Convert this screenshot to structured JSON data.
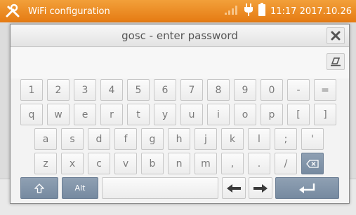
{
  "statusbar": {
    "title": "WiFi configuration",
    "time": "11:17 2017.10.26",
    "icons": [
      "tools-icon",
      "signal-icon",
      "plug-icon",
      "battery-icon"
    ]
  },
  "dialog": {
    "title": "gosc - enter password",
    "password_value": "",
    "close_icon": "close-icon",
    "clear_icon": "eraser-icon"
  },
  "keyboard": {
    "row1": [
      "1",
      "2",
      "3",
      "4",
      "5",
      "6",
      "7",
      "8",
      "9",
      "0",
      "-",
      "="
    ],
    "row2": [
      "q",
      "w",
      "e",
      "r",
      "t",
      "y",
      "u",
      "i",
      "o",
      "p",
      "[",
      "]"
    ],
    "row3": [
      "a",
      "s",
      "d",
      "f",
      "g",
      "h",
      "j",
      "k",
      "l",
      ";",
      "'"
    ],
    "row4": [
      "z",
      "x",
      "c",
      "v",
      "b",
      "n",
      "m",
      ",",
      ".",
      "/"
    ],
    "shift_icon": "shift-icon",
    "alt_label": "Alt",
    "backspace_icon": "backspace-icon",
    "left_arrow_icon": "arrow-left-icon",
    "right_arrow_icon": "arrow-right-icon",
    "enter_icon": "enter-icon"
  },
  "colors": {
    "statusbar": "#e98a1e",
    "dark_key": "#7f92a8"
  }
}
